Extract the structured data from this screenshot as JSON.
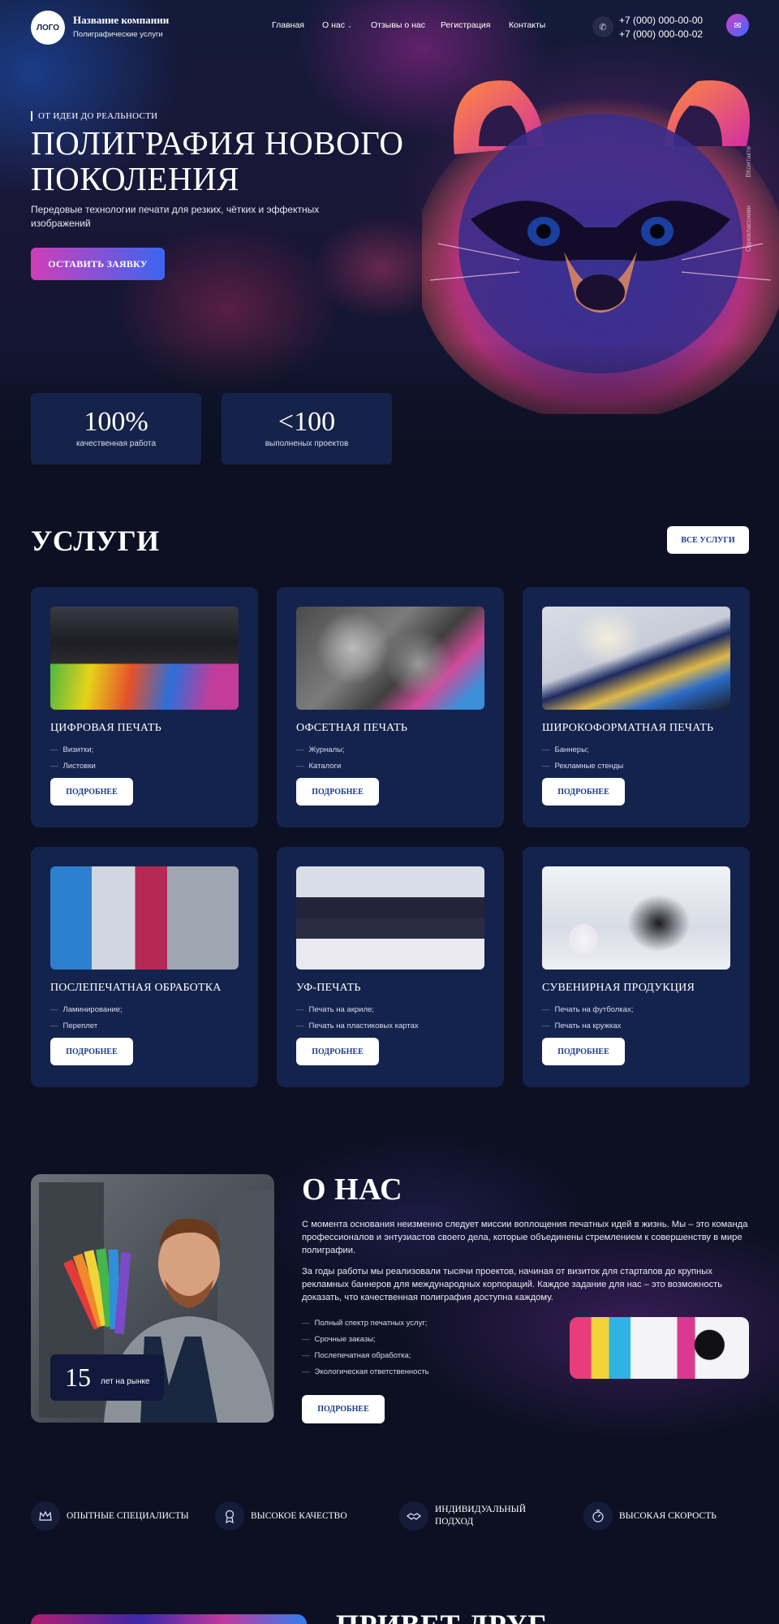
{
  "header": {
    "logo_text": "ЛОГО",
    "company_name": "Название компании",
    "company_sub": "Полиграфические услуги",
    "nav": [
      "Главная",
      "О нас",
      "Отзывы о нас",
      "Регистрация",
      "Контакты"
    ],
    "phones": [
      "+7 (000) 000-00-00",
      "+7 (000) 000-00-02"
    ]
  },
  "hero": {
    "eyebrow": "ОТ ИДЕИ ДО РЕАЛЬНОСТИ",
    "title": "ПОЛИГРАФИЯ НОВОГО ПОКОЛЕНИЯ",
    "subtitle": "Передовые технологии печати для резких, чётких и эффектных изображений",
    "cta": "ОСТАВИТЬ ЗАЯВКУ",
    "social": [
      "Одноклассники",
      "ВКонтакте"
    ]
  },
  "stats": [
    {
      "value": "100%",
      "label": "качественная работа"
    },
    {
      "value": "<100",
      "label": "выполненых проектов"
    }
  ],
  "services": {
    "title": "УСЛУГИ",
    "all_button": "ВСЕ УСЛУГИ",
    "more_label": "ПОДРОБНЕЕ",
    "items": [
      {
        "title": "ЦИФРОВАЯ ПЕЧАТЬ",
        "points": [
          "Визитки;",
          "Листовки"
        ]
      },
      {
        "title": "ОФСЕТНАЯ ПЕЧАТЬ",
        "points": [
          "Журналы;",
          "Каталоги"
        ]
      },
      {
        "title": "ШИРОКОФОРМАТНАЯ ПЕЧАТЬ",
        "points": [
          "Баннеры;",
          "Рекламные стенды"
        ]
      },
      {
        "title": "ПОСЛЕПЕЧАТНАЯ ОБРАБОТКА",
        "points": [
          "Ламинирование;",
          "Переплет"
        ]
      },
      {
        "title": "УФ-ПЕЧАТЬ",
        "points": [
          "Печать на акриле;",
          "Печать на пластиковых картах"
        ]
      },
      {
        "title": "СУВЕНИРНАЯ ПРОДУКЦИЯ",
        "points": [
          "Печать на футболках;",
          "Печать на кружках"
        ]
      }
    ]
  },
  "about": {
    "title": "О НАС",
    "paragraphs": [
      "С момента основания  неизменно следует миссии воплощения печатных идей в жизнь. Мы – это команда профессионалов и энтузиастов своего дела, которые объединены стремлением к совершенству в мире полиграфии.",
      "За годы работы мы реализовали тысячи проектов, начиная от визиток для стартапов до крупных рекламных баннеров для международных корпораций. Каждое задание для нас – это возможность доказать, что качественная полиграфия доступна каждому."
    ],
    "points": [
      "Полный спектр печатных услуг;",
      "Срочные заказы;",
      "Послепечатная обработка;",
      "Экологическая ответственность"
    ],
    "years_value": "15",
    "years_label": "лет на рынке",
    "button": "ПОДРОБНЕЕ"
  },
  "features": [
    {
      "icon": "crown-icon",
      "label": "ОПЫТНЫЕ СПЕЦИАЛИСТЫ"
    },
    {
      "icon": "medal-icon",
      "label": "ВЫСОКОЕ КАЧЕСТВО"
    },
    {
      "icon": "handshake-icon",
      "label": "ИНДИВИДУАЛЬНЫЙ ПОДХОД"
    },
    {
      "icon": "stopwatch-icon",
      "label": "ВЫСОКАЯ СКОРОСТЬ"
    }
  ],
  "next_section": {
    "title": "ПРИВЕТ ДРУГ"
  },
  "colors": {
    "background": "#0c1022",
    "card": "#14234d",
    "accent_start": "#cf3fb8",
    "accent_end": "#3c65f0",
    "button_text": "#1a3c8e"
  }
}
